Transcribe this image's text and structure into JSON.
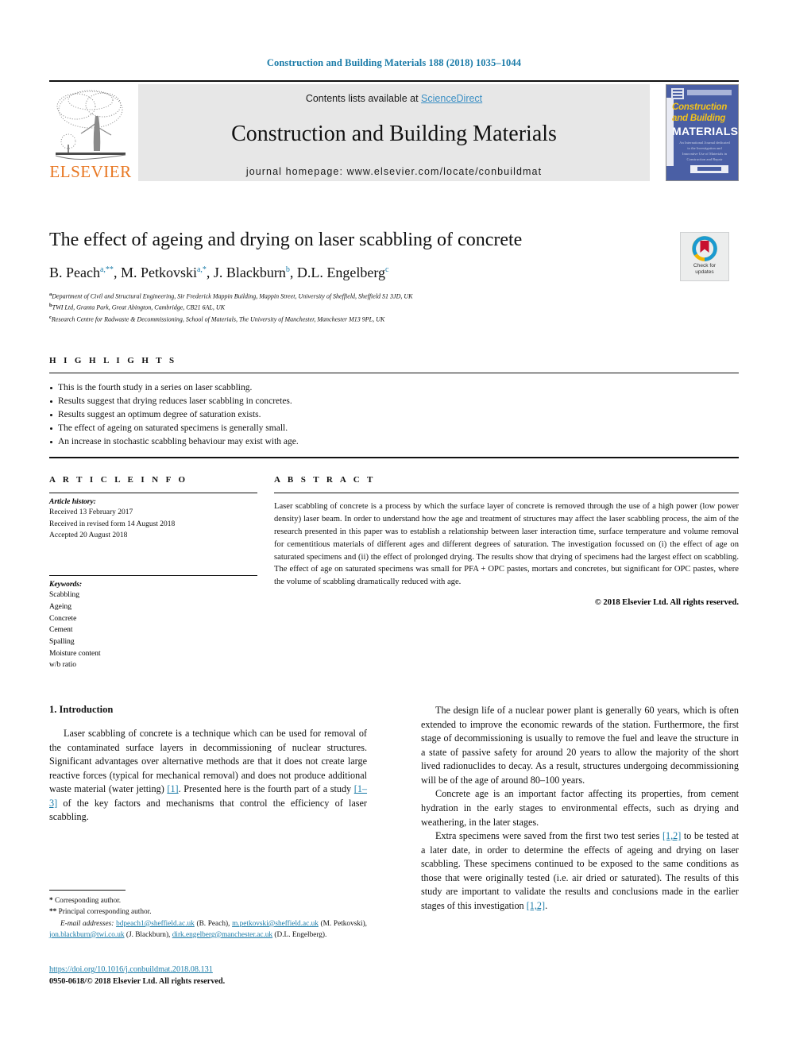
{
  "running_head": "Construction and Building Materials 188 (2018) 1035–1044",
  "masthead": {
    "publisher": "ELSEVIER",
    "contents_prefix": "Contents lists available at ",
    "contents_link": "ScienceDirect",
    "journal_title": "Construction and Building Materials",
    "homepage": "journal homepage: www.elsevier.com/locate/conbuildmat",
    "cover": {
      "line1": "Construction",
      "line2": "and Building",
      "line3": "MATERIALS",
      "blurb": "An International Journal dedicated to the Investigation and Innovative Use of Materials in Construction and Repair"
    }
  },
  "article": {
    "title": "The effect of ageing and drying on laser scabbling of concrete",
    "authors": [
      {
        "name": "B. Peach",
        "sup": "a,**"
      },
      {
        "name": "M. Petkovski",
        "sup": "a,*"
      },
      {
        "name": "J. Blackburn",
        "sup": "b"
      },
      {
        "name": "D.L. Engelberg",
        "sup": "c"
      }
    ],
    "affiliations": [
      {
        "marker": "a",
        "text": "Department of Civil and Structural Engineering, Sir Frederick Mappin Building, Mappin Street, University of Sheffield, Sheffield S1 3JD, UK"
      },
      {
        "marker": "b",
        "text": "TWI Ltd, Granta Park, Great Abington, Cambridge, CB21 6AL, UK"
      },
      {
        "marker": "c",
        "text": "Research Centre for Radwaste & Decommissioning, School of Materials, The University of Manchester, Manchester M13 9PL, UK"
      }
    ],
    "crossmark": {
      "line1": "Check for",
      "line2": "updates"
    }
  },
  "highlights": {
    "label": "H I G H L I G H T S",
    "items": [
      "This is the fourth study in a series on laser scabbling.",
      "Results suggest that drying reduces laser scabbling in concretes.",
      "Results suggest an optimum degree of saturation exists.",
      "The effect of ageing on saturated specimens is generally small.",
      "An increase in stochastic scabbling behaviour may exist with age."
    ]
  },
  "article_info": {
    "label": "A R T I C L E   I N F O",
    "history_label": "Article history:",
    "history": [
      "Received 13 February 2017",
      "Received in revised form 14 August 2018",
      "Accepted 20 August 2018"
    ],
    "keywords_label": "Keywords:",
    "keywords": [
      "Scabbling",
      "Ageing",
      "Concrete",
      "Cement",
      "Spalling",
      "Moisture content",
      "w/b ratio"
    ]
  },
  "abstract": {
    "label": "A B S T R A C T",
    "text": "Laser scabbling of concrete is a process by which the surface layer of concrete is removed through the use of a high power (low power density) laser beam. In order to understand how the age and treatment of structures may affect the laser scabbling process, the aim of the research presented in this paper was to establish a relationship between laser interaction time, surface temperature and volume removal for cementitious materials of different ages and different degrees of saturation. The investigation focussed on (i) the effect of age on saturated specimens and (ii) the effect of prolonged drying. The results show that drying of specimens had the largest effect on scabbling. The effect of age on saturated specimens was small for PFA + OPC pastes, mortars and concretes, but significant for OPC pastes, where the volume of scabbling dramatically reduced with age.",
    "copyright": "© 2018 Elsevier Ltd. All rights reserved."
  },
  "introduction": {
    "heading": "1. Introduction",
    "left_paragraphs": [
      {
        "parts": [
          {
            "t": "Laser scabbling of concrete is a technique which can be used for removal of the contaminated surface layers in decommissioning of nuclear structures. Significant advantages over alternative methods are that it does not create large reactive forces (typical for mechanical removal) and does not produce additional waste material (water jetting) "
          },
          {
            "t": "[1]",
            "ref": true
          },
          {
            "t": ". Presented here is the fourth part of a study "
          },
          {
            "t": "[1–3]",
            "ref": true
          },
          {
            "t": " of the key factors and mechanisms that control the efficiency of laser scabbling."
          }
        ]
      }
    ],
    "right_paragraphs": [
      {
        "parts": [
          {
            "t": "The design life of a nuclear power plant is generally 60 years, which is often extended to improve the economic rewards of the station. Furthermore, the first stage of decommissioning is usually to remove the fuel and leave the structure in a state of passive safety for around 20 years to allow the majority of the short lived radionuclides to decay. As a result, structures undergoing decommissioning will be of the age of around 80–100 years."
          }
        ]
      },
      {
        "parts": [
          {
            "t": "Concrete age is an important factor affecting its properties, from cement hydration in the early stages to environmental effects, such as drying and weathering, in the later stages."
          }
        ]
      },
      {
        "parts": [
          {
            "t": "Extra specimens were saved from the first two test series "
          },
          {
            "t": "[1,2]",
            "ref": true
          },
          {
            "t": " to be tested at a later date, in order to determine the effects of ageing and drying on laser scabbling. These specimens continued to be exposed to the same conditions as those that were originally tested (i.e. air dried or saturated). The results of this study are important to validate the results and conclusions made in the earlier stages of this investigation "
          },
          {
            "t": "[1,2]",
            "ref": true
          },
          {
            "t": "."
          }
        ]
      }
    ]
  },
  "footnotes": {
    "corresponding": "Corresponding author.",
    "corresponding_marker": "*",
    "principal": "Principal corresponding author.",
    "principal_marker": "**",
    "email_label": "E-mail addresses:",
    "emails": [
      {
        "addr": "bdpeach1@sheffield.ac.uk",
        "who": "(B. Peach)"
      },
      {
        "addr": "m.petkovski@sheffield.ac.uk",
        "who": "(M. Petkovski)"
      },
      {
        "addr": "jon.blackburn@twi.co.uk",
        "who": "(J. Blackburn)"
      },
      {
        "addr": "dirk.engelberg@manchester.ac.uk",
        "who": "(D.L. Engelberg)"
      }
    ],
    "doi": "https://doi.org/10.1016/j.conbuildmat.2018.08.131",
    "issn_line": "0950-0618/© 2018 Elsevier Ltd. All rights reserved."
  },
  "colors": {
    "link_blue": "#1a7ba8",
    "sciencedirect_blue": "#3b8fc4",
    "elsevier_orange": "#E87722",
    "band_grey": "#e7e7e7"
  }
}
